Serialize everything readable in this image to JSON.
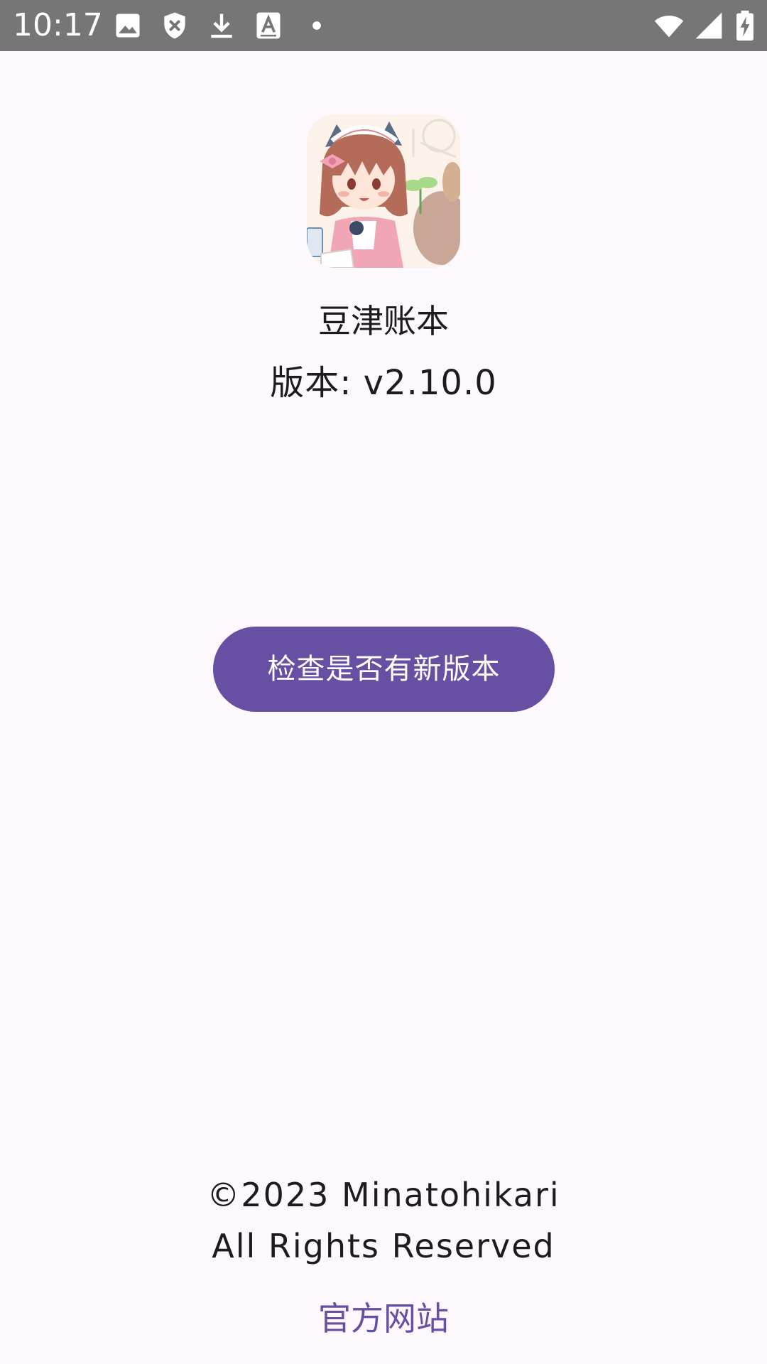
{
  "status_bar": {
    "time": "10:17",
    "icons": [
      "image-icon",
      "shield-x-icon",
      "download-icon",
      "font-icon",
      "dot-icon",
      "wifi-icon",
      "cell-signal-icon",
      "battery-charging-icon"
    ]
  },
  "app": {
    "name": "豆津账本",
    "version": "版本: v2.10.0"
  },
  "actions": {
    "check_update_label": "检查是否有新版本"
  },
  "footer": {
    "copyright_line1": "©2023 Minatohikari",
    "copyright_line2": "All Rights Reserved",
    "official_site_label": "官方网站"
  },
  "colors": {
    "background": "#fdf7fe",
    "accent": "#6750a4",
    "status_bar": "#767676"
  }
}
